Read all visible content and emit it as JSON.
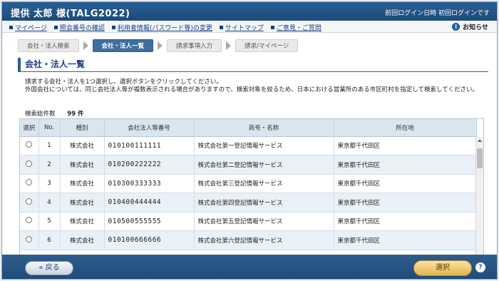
{
  "header": {
    "title": "提供 太郎 様(TALG2022)",
    "last_login": "前回ログイン日時 初回ログインです"
  },
  "nav": {
    "links": [
      "マイページ",
      "照会番号の確認",
      "利用者情報(パスワード等)の変更",
      "サイトマップ",
      "ご意見・ご質問"
    ],
    "notice": "お知らせ"
  },
  "steps": [
    "会社・法人検索",
    "会社・法人一覧",
    "請求事項入力",
    "請求/マイページ"
  ],
  "section": {
    "title": "会社・法人一覧",
    "desc1": "請求する会社・法人を1つ選択し、選択ボタンをクリックしてください。",
    "desc2": "外国会社については、同じ会社法人等が複数表示される場合がありますので、検索対象を絞るため、日本における営業所のある市区町村を指定して検索してください。",
    "count_label": "検索総件数",
    "count_value": "99 件"
  },
  "table": {
    "headers": [
      "選択",
      "No.",
      "種別",
      "会社法人等番号",
      "商号・名称",
      "所在地"
    ],
    "rows": [
      {
        "no": "1",
        "type": "株式会社",
        "number": "010100111111",
        "name": "株式会社第一登記情報サービス",
        "location": "東京都千代田区"
      },
      {
        "no": "2",
        "type": "株式会社",
        "number": "010200222222",
        "name": "株式会社第二登記情報サービス",
        "location": "東京都千代田区"
      },
      {
        "no": "3",
        "type": "株式会社",
        "number": "010300333333",
        "name": "株式会社第三登記情報サービス",
        "location": "東京都千代田区"
      },
      {
        "no": "4",
        "type": "株式会社",
        "number": "010400444444",
        "name": "株式会社第四登記情報サービス",
        "location": "東京都千代田区"
      },
      {
        "no": "5",
        "type": "株式会社",
        "number": "010500555555",
        "name": "株式会社第五登記情報サービス",
        "location": "東京都千代田区"
      },
      {
        "no": "6",
        "type": "株式会社",
        "number": "010100666666",
        "name": "株式会社第六登記情報サービス",
        "location": "東京都千代田区"
      }
    ]
  },
  "footer": {
    "back_label": "« 戻る",
    "select_label": "選択",
    "help_label": "?"
  },
  "colors": {
    "header_bg": "#1d4a7a",
    "accent": "#2a5f95",
    "select_button": "#e4b34a"
  }
}
